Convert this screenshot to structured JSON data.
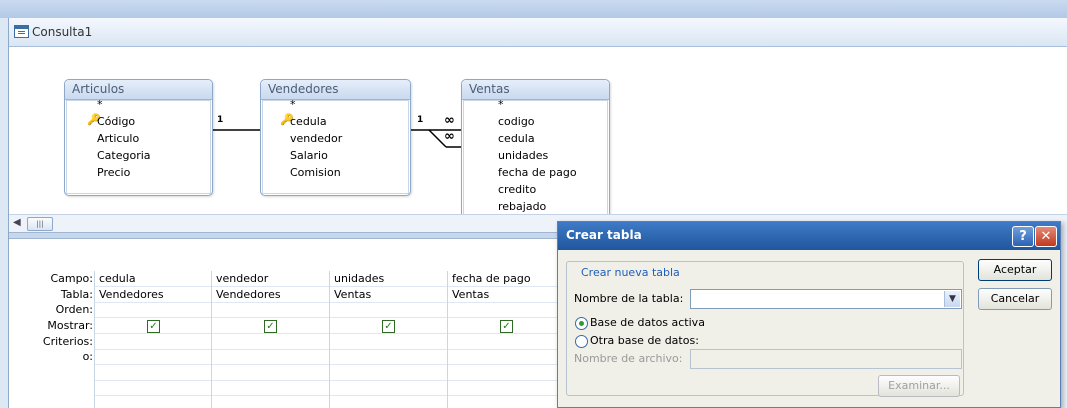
{
  "window": {
    "title": "Consulta1"
  },
  "tables": [
    {
      "name": "Articulos",
      "fields": [
        "*",
        "Código",
        "Articulo",
        "Categoria",
        "Precio"
      ]
    },
    {
      "name": "Vendedores",
      "fields": [
        "*",
        "cedula",
        "vendedor",
        "Salario",
        "Comision"
      ]
    },
    {
      "name": "Ventas",
      "fields": [
        "*",
        "codigo",
        "cedula",
        "unidades",
        "fecha de pago",
        "credito",
        "rebajado"
      ]
    }
  ],
  "relations": {
    "one": "1",
    "many": "∞"
  },
  "grid": {
    "row_labels": [
      "Campo:",
      "Tabla:",
      "Orden:",
      "Mostrar:",
      "Criterios:",
      "o:"
    ],
    "columns": [
      {
        "field": "cedula",
        "table": "Vendedores"
      },
      {
        "field": "vendedor",
        "table": "Vendedores"
      },
      {
        "field": "unidades",
        "table": "Ventas"
      },
      {
        "field": "fecha de pago",
        "table": "Ventas"
      }
    ]
  },
  "dialog": {
    "title": "Crear tabla",
    "help": "?",
    "close": "✕",
    "group_label": "Crear nueva tabla",
    "table_name_label": "Nombre de la tabla:",
    "table_name_value": "",
    "radio_active": "Base de datos activa",
    "radio_other": "Otra base de datos:",
    "file_label": "Nombre de archivo:",
    "browse": "Examinar...",
    "ok": "Aceptar",
    "cancel": "Cancelar"
  },
  "colors": {
    "title_blue": "#2b62b4",
    "close_red": "#c0391f",
    "check_green": "#1f7a1f"
  }
}
